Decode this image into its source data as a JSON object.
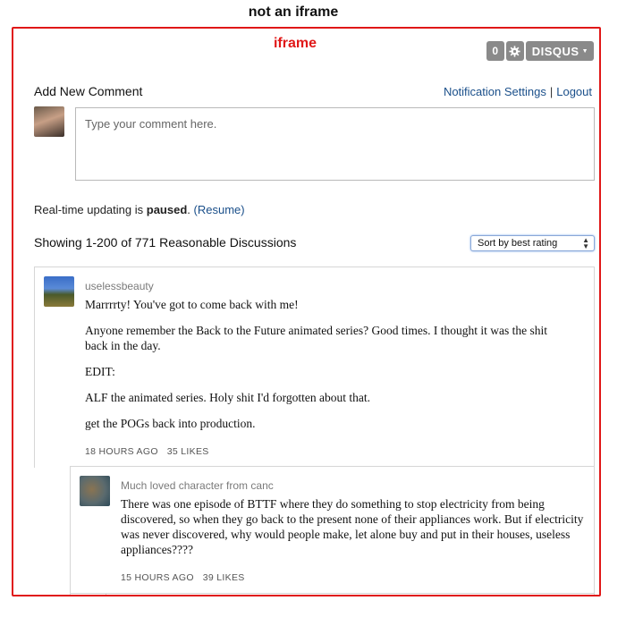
{
  "outer_label": "not an iframe",
  "frame": {
    "label": "iframe",
    "toolbar": {
      "count": "0",
      "brand": "DISQUS"
    },
    "add_new_label": "Add New Comment",
    "links": {
      "notifications": "Notification Settings",
      "separator": "|",
      "logout": "Logout"
    },
    "comment_placeholder": "Type your comment here.",
    "realtime": {
      "prefix": "Real-time updating is",
      "status": "paused",
      "suffix": ".",
      "resume": "(Resume)"
    },
    "showing": "Showing 1-200 of 771 Reasonable Discussions",
    "sort": {
      "selected": "Sort by best rating"
    },
    "posts": [
      {
        "author": "uselessbeauty",
        "paragraphs": [
          "Marrrrty! You've got to come back with me!",
          "Anyone remember the Back to the Future animated series? Good times. I thought it was the shit back in the day.",
          "EDIT:",
          "ALF the animated series. Holy shit I'd forgotten about that.",
          "get the POGs back into production."
        ],
        "time": "18 HOURS AGO",
        "likes": "35 LIKES"
      },
      {
        "author": "Much loved character from canc",
        "paragraphs": [
          "There was one episode of BTTF where they do something to stop electricity from being discovered, so when they go back to the present none of their appliances work.  But if electricity was never discovered, why would people make, let alone buy and put in their houses, useless appliances????"
        ],
        "time": "15 HOURS AGO",
        "likes": "39 LIKES"
      }
    ]
  },
  "colors": {
    "frame_border": "#e01818",
    "link": "#1a4f8a",
    "toolbar_bg": "#8a8a8a"
  },
  "icons": {
    "settings": "gear-icon",
    "dropdown": "caret-down-icon",
    "select_arrows": "up-down-arrows-icon"
  }
}
